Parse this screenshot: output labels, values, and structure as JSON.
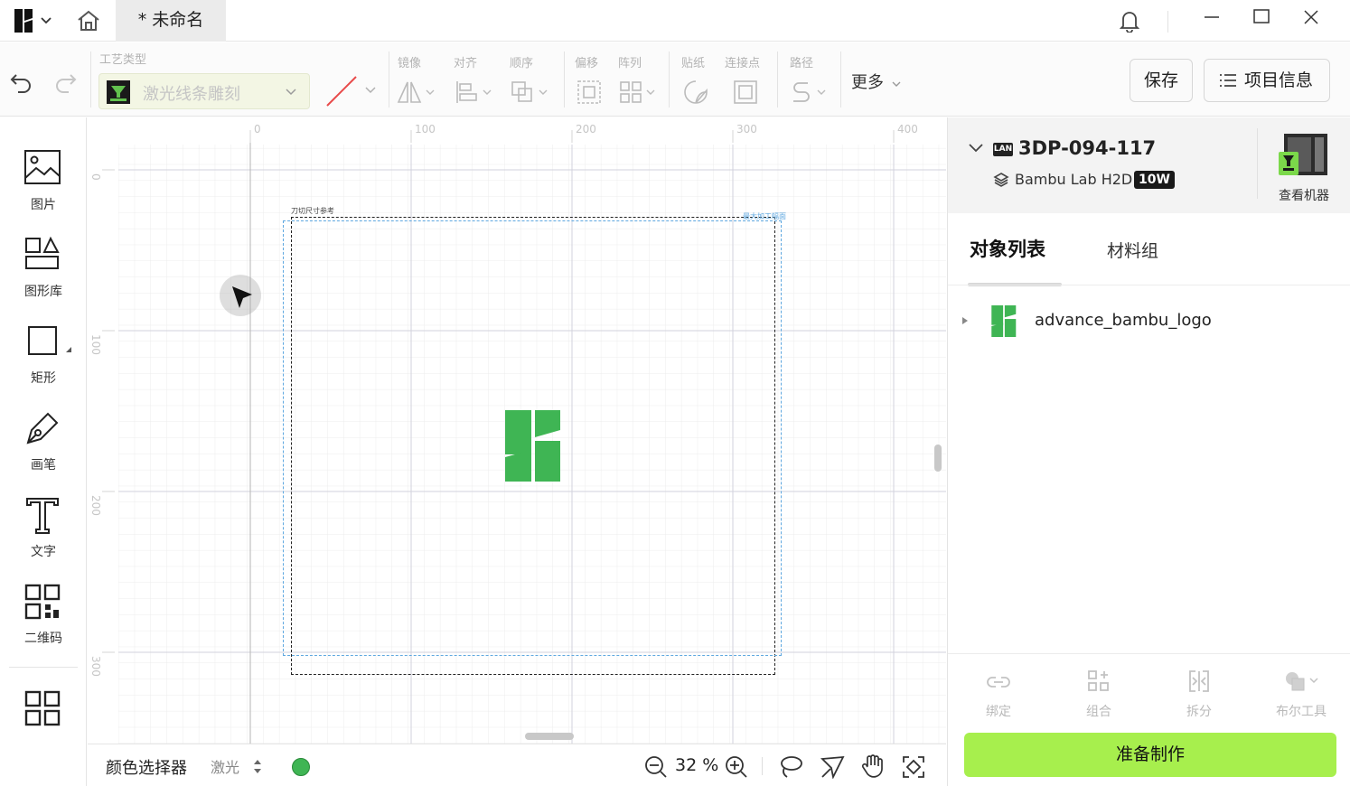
{
  "titlebar": {
    "app_icon": "bambu-app-logo-icon",
    "home_icon": "home-icon",
    "doc_tab": "* 未命名",
    "notification_icon": "bell-icon",
    "window_controls": [
      "minimize-icon",
      "maximize-icon",
      "close-icon"
    ]
  },
  "toolbar": {
    "process_type_label": "工艺类型",
    "process_type_value": "激光线条雕刻",
    "groups": {
      "mirror": "镜像",
      "align": "对齐",
      "order": "顺序",
      "offset": "偏移",
      "array": "阵列",
      "sticker": "贴纸",
      "connect": "连接点",
      "path": "路径"
    },
    "more_label": "更多",
    "save_label": "保存",
    "project_info_label": "项目信息",
    "accent_color": "#a7ef4d"
  },
  "left_tools": [
    {
      "label": "图片",
      "icon": "image-icon"
    },
    {
      "label": "图形库",
      "icon": "shape-library-icon"
    },
    {
      "label": "矩形",
      "icon": "rectangle-icon"
    },
    {
      "label": "画笔",
      "icon": "pen-icon"
    },
    {
      "label": "文字",
      "icon": "text-icon"
    },
    {
      "label": "二维码",
      "icon": "qr-code-icon"
    },
    {
      "label": "",
      "icon": "grid-apps-icon"
    }
  ],
  "canvas": {
    "ruler_top": [
      "0",
      "100",
      "200",
      "300",
      "400"
    ],
    "ruler_left": [
      "0",
      "100",
      "200",
      "300"
    ],
    "crop_label": "刀切尺寸参考",
    "selection_label": "最大加工幅面",
    "logo_color": "#3fb554"
  },
  "bottom_bar": {
    "color_picker_label": "颜色选择器",
    "mode_value": "激光",
    "color_dot": "#3fb554",
    "zoom_value": "32 %"
  },
  "machine": {
    "name": "3DP-094-117",
    "connection_badge": "LAN",
    "model": "Bambu Lab H2D",
    "power_badge": "10W",
    "view_machine_label": "查看机器"
  },
  "object_panel": {
    "tabs": [
      "对象列表",
      "材料组"
    ],
    "objects": [
      {
        "name": "advance_bambu_logo"
      }
    ]
  },
  "bottom_tools": [
    {
      "label": "绑定",
      "icon": "link-icon"
    },
    {
      "label": "组合",
      "icon": "group-icon"
    },
    {
      "label": "拆分",
      "icon": "split-icon"
    },
    {
      "label": "布尔工具",
      "icon": "boolean-icon"
    }
  ],
  "prepare_label": "准备制作"
}
